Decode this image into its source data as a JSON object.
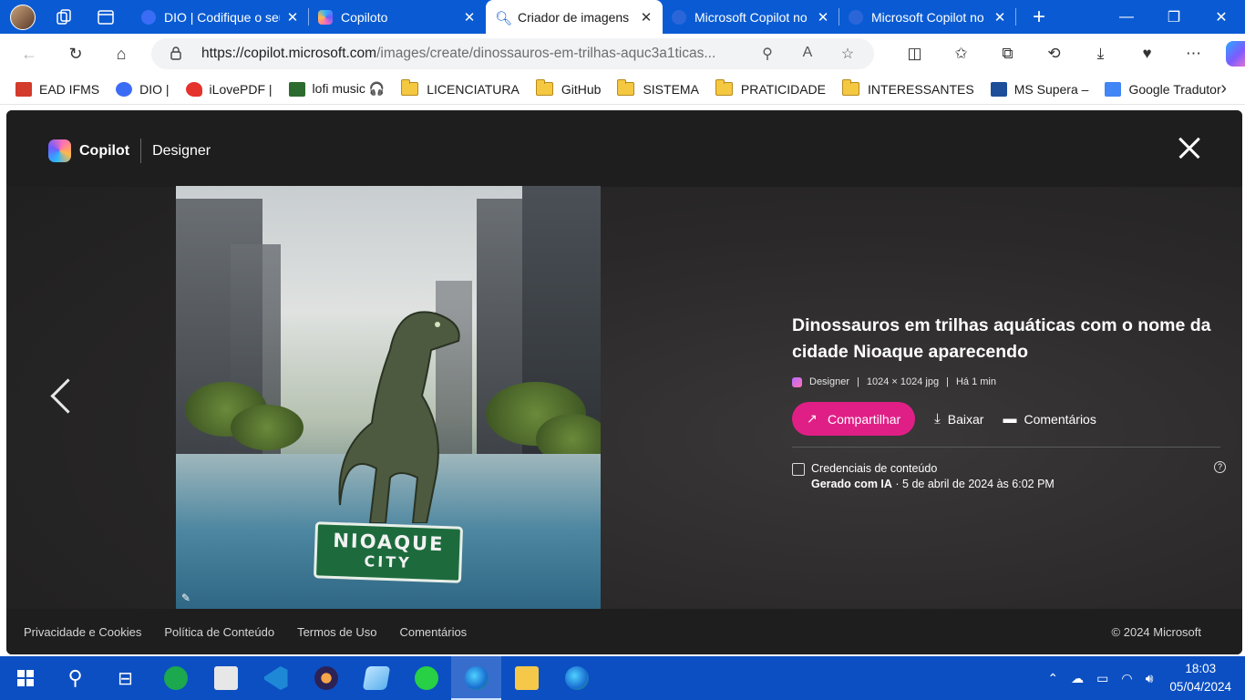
{
  "tabs": [
    {
      "title": "DIO | Codifique o seu futuro",
      "active": false
    },
    {
      "title": "Copiloto",
      "active": false
    },
    {
      "title": "Criador de imagens",
      "active": true
    },
    {
      "title": "Microsoft Copilot no Bing",
      "active": false
    },
    {
      "title": "Microsoft Copilot no Bing",
      "active": false
    }
  ],
  "address": {
    "url_domain": "https://copilot.microsoft.com",
    "url_path": "/images/create/dinossauros-em-trilhas-aquc3a1ticas..."
  },
  "favorites": [
    {
      "label": "EAD IFMS",
      "icon": "ifms-icon",
      "color": "#d33b2c"
    },
    {
      "label": "DIO |",
      "icon": "dio-icon",
      "color": "#3b6cf5"
    },
    {
      "label": "iLovePDF |",
      "icon": "ilovepdf-icon",
      "color": "#e5322d"
    },
    {
      "label": "lofi music 🎧",
      "icon": "lofi-icon",
      "color": "#2c6b2f"
    },
    {
      "label": "LICENCIATURA",
      "icon": "folder-icon"
    },
    {
      "label": "GitHub",
      "icon": "folder-icon"
    },
    {
      "label": "SISTEMA",
      "icon": "folder-icon"
    },
    {
      "label": "PRATICIDADE",
      "icon": "folder-icon"
    },
    {
      "label": "INTERESSANTES",
      "icon": "folder-icon"
    },
    {
      "label": "MS Supera –",
      "icon": "ms-supera-icon",
      "color": "#1e4e9a"
    },
    {
      "label": "Google Tradutor",
      "icon": "google-translate-icon",
      "color": "#4285f4"
    }
  ],
  "viewer": {
    "brand": "Copilot",
    "product": "Designer",
    "image_sign_line1": "NIOAQUE",
    "image_sign_line2": "CITY",
    "title": "Dinossauros em trilhas aquáticas com o nome da cidade Nioaque aparecendo",
    "meta_source": "Designer",
    "meta_size": "1024 × 1024 jpg",
    "meta_time": "Há 1 min",
    "share_label": "Compartilhar",
    "download_label": "Baixar",
    "comments_label": "Comentários",
    "credentials_label": "Credenciais de conteúdo",
    "credentials_generated": "Gerado com IA",
    "credentials_date": "· 5 de abril de 2024 às 6:02 PM"
  },
  "footer": {
    "links": [
      "Privacidade e Cookies",
      "Política de Conteúdo",
      "Termos de Uso",
      "Comentários"
    ],
    "copyright": "© 2024 Microsoft"
  },
  "taskbar": {
    "time": "18:03",
    "date": "05/04/2024"
  },
  "colors": {
    "tab_strip": "#0a5bd3",
    "share_button": "#e01f86",
    "viewer_bg": "#1e1e1e",
    "taskbar": "#0b4fc2"
  }
}
